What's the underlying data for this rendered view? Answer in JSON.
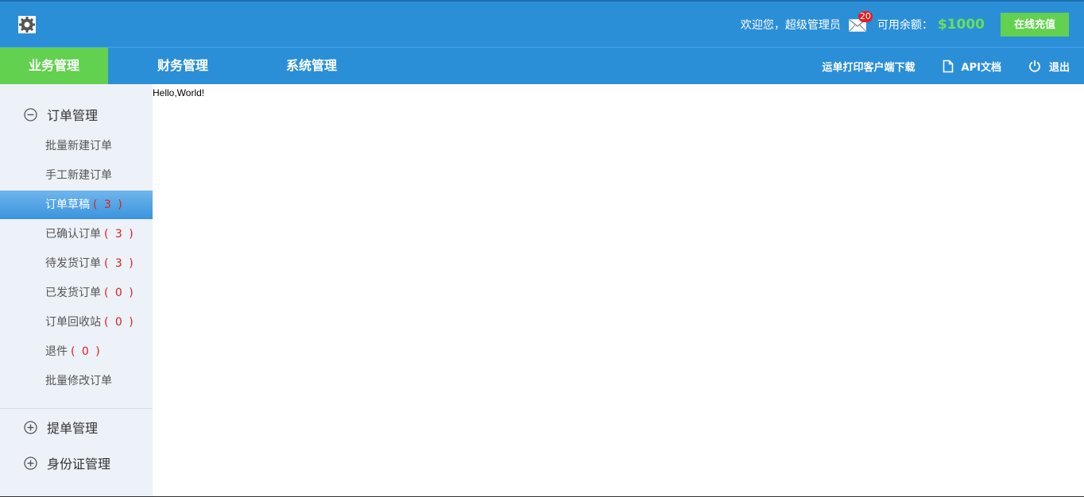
{
  "header": {
    "logo_icon": "gear-icon",
    "welcome_text": "欢迎您，超级管理员",
    "mail_icon": "mail-icon",
    "mail_badge": "20",
    "balance_label": "可用余额：",
    "balance_value": "$1000",
    "recharge_label": "在线充值"
  },
  "nav": {
    "tabs": [
      {
        "label": "业务管理",
        "active": true
      },
      {
        "label": "财务管理",
        "active": false
      },
      {
        "label": "系统管理",
        "active": false
      }
    ],
    "links": [
      {
        "label": "运单打印客户端下载",
        "icon": ""
      },
      {
        "label": "API文档",
        "icon": "document-icon"
      },
      {
        "label": "退出",
        "icon": "power-icon"
      }
    ]
  },
  "sidebar": {
    "groups": [
      {
        "label": "订单管理",
        "icon": "minus-circle-icon",
        "expanded": true,
        "items": [
          {
            "label": "批量新建订单",
            "count": ""
          },
          {
            "label": "手工新建订单",
            "count": ""
          },
          {
            "label": "订单草稿",
            "count": "( 3 )",
            "active": true
          },
          {
            "label": "已确认订单",
            "count": "( 3 )"
          },
          {
            "label": "待发货订单",
            "count": "( 3 )"
          },
          {
            "label": "已发货订单",
            "count": "( 0 )"
          },
          {
            "label": "订单回收站",
            "count": "( 0 )"
          },
          {
            "label": "退件",
            "count": "( 0 )"
          },
          {
            "label": "批量修改订单",
            "count": ""
          }
        ]
      },
      {
        "label": "提单管理",
        "icon": "plus-circle-icon",
        "expanded": false
      },
      {
        "label": "身份证管理",
        "icon": "plus-circle-icon",
        "expanded": false
      }
    ]
  },
  "content": {
    "text": "Hello,World!"
  },
  "colors": {
    "primary": "#2b8fd8",
    "accent_green": "#62d14f",
    "balance_green": "#66e05a",
    "badge_red": "#e02020",
    "sidebar_bg": "#edf1f8"
  }
}
